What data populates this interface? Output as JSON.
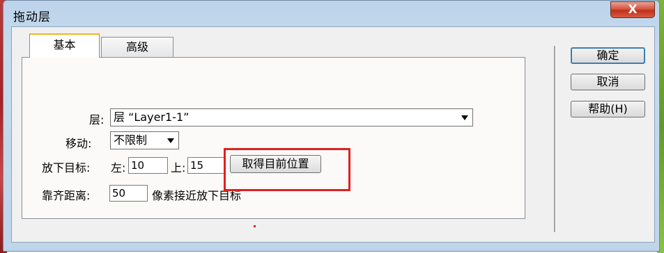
{
  "window": {
    "title": "拖动层",
    "close_glyph": "X"
  },
  "tabs": [
    {
      "label": "基本",
      "selected": true
    },
    {
      "label": "高级",
      "selected": false
    }
  ],
  "form": {
    "layer_label": "层:",
    "layer_value": "层 “Layer1-1”",
    "move_label": "移动:",
    "move_value": "不限制",
    "drop_target_label": "放下目标:",
    "left_label": "左:",
    "left_value": "10",
    "top_label": "上:",
    "top_value": "15",
    "get_position_button": "取得目前位置",
    "snap_label": "靠齐距离:",
    "snap_value": "50",
    "snap_suffix": "像素接近放下目标"
  },
  "buttons": {
    "ok": "确定",
    "cancel": "取消",
    "help": "帮助(H)"
  },
  "colors": {
    "highlight": "#e02020",
    "tab_accent": "#f3b51b"
  }
}
